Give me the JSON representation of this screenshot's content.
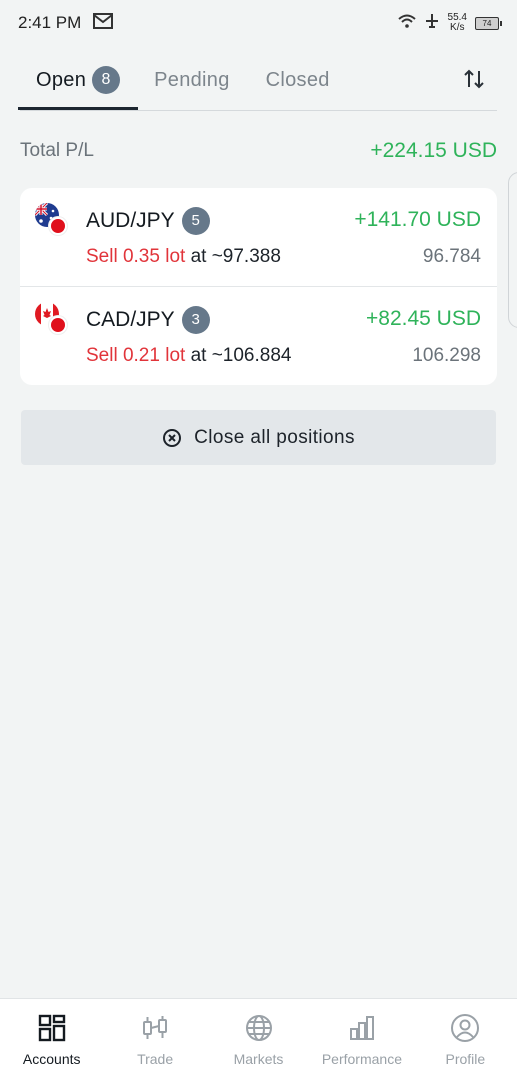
{
  "status_bar": {
    "time": "2:41 PM",
    "net_speed_value": "55.4",
    "net_speed_unit": "K/s",
    "battery": "74"
  },
  "tabs": [
    {
      "label": "Open",
      "count": "8",
      "active": true
    },
    {
      "label": "Pending"
    },
    {
      "label": "Closed"
    }
  ],
  "summary": {
    "total_label": "Total P/L",
    "total_value": "+224.15 USD"
  },
  "positions": [
    {
      "pair": "AUD/JPY",
      "count": "5",
      "pnl": "+141.70 USD",
      "side_lot": "Sell 0.35 lot",
      "at_price": "at ~97.388",
      "current_price": "96.784"
    },
    {
      "pair": "CAD/JPY",
      "count": "3",
      "pnl": "+82.45 USD",
      "side_lot": "Sell 0.21 lot",
      "at_price": "at ~106.884",
      "current_price": "106.298"
    }
  ],
  "close_all_label": "Close all positions",
  "bottom_nav": [
    {
      "label": "Accounts",
      "icon": "accounts-icon",
      "active": true
    },
    {
      "label": "Trade",
      "icon": "trade-icon"
    },
    {
      "label": "Markets",
      "icon": "globe-icon"
    },
    {
      "label": "Performance",
      "icon": "bar-chart-icon"
    },
    {
      "label": "Profile",
      "icon": "profile-icon"
    }
  ],
  "colors": {
    "profit": "#2fb35a",
    "sell": "#e1343a",
    "badge": "#66788a",
    "background": "#f2f4f4"
  }
}
